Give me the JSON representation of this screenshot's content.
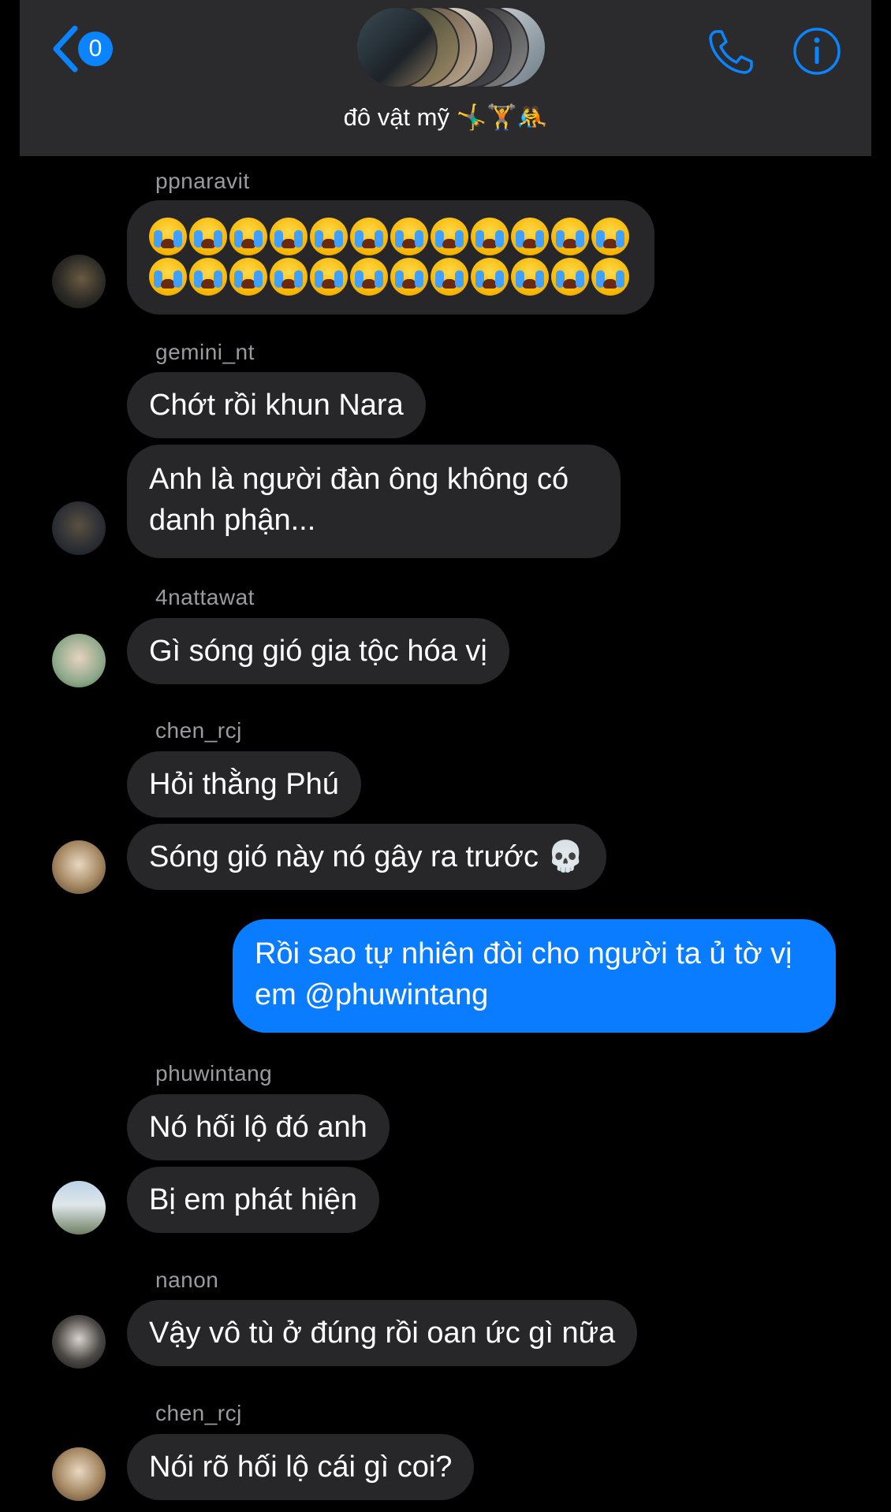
{
  "header": {
    "back_badge": "0",
    "group_title": "đô vật mỹ 🤸‍♂️🏋️🤼",
    "icons": {
      "back": "chevron-left-icon",
      "call": "phone-icon",
      "info": "info-icon"
    },
    "accent_color": "#0a84ff"
  },
  "messages": [
    {
      "sender": "ppnaravit",
      "texts": [
        "😭😭😭😭😭😭😭😭😭😭😭😭😭😭😭😭😭😭😭😭😭😭😭😭"
      ]
    },
    {
      "sender": "gemini_nt",
      "texts": [
        "Chớt rồi khun Nara",
        "Anh là người đàn ông không có danh phận..."
      ]
    },
    {
      "sender": "4nattawat",
      "texts": [
        "Gì sóng gió gia tộc hóa vị"
      ]
    },
    {
      "sender": "chen_rcj",
      "texts": [
        "Hỏi thằng Phú",
        "Sóng gió này nó gây ra trước 💀"
      ]
    },
    {
      "sender": "me",
      "texts": [
        "Rồi sao tự nhiên đòi cho người ta ủ tờ vị em @phuwintang"
      ]
    },
    {
      "sender": "phuwintang",
      "texts": [
        "Nó hối lộ đó anh",
        "Bị em phát hiện"
      ]
    },
    {
      "sender": "nanon",
      "texts": [
        "Vậy vô tù ở đúng rồi oan ức gì nữa"
      ]
    },
    {
      "sender": "chen_rcj",
      "texts": [
        "Nói rõ hối lộ cái gì coi?"
      ]
    }
  ],
  "colors": {
    "incoming_bubble": "#27272a",
    "outgoing_bubble": "#0a7cff",
    "background": "#000000"
  }
}
